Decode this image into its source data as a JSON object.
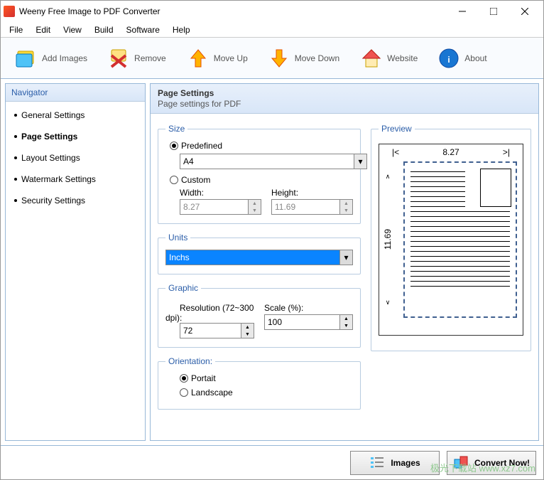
{
  "window": {
    "title": "Weeny Free Image to PDF Converter"
  },
  "menu": {
    "file": "File",
    "edit": "Edit",
    "view": "View",
    "build": "Build",
    "software": "Software",
    "help": "Help"
  },
  "toolbar": {
    "add": "Add Images",
    "remove": "Remove",
    "moveup": "Move Up",
    "movedown": "Move Down",
    "website": "Website",
    "about": "About"
  },
  "navigator": {
    "title": "Navigator",
    "items": [
      "General Settings",
      "Page Settings",
      "Layout Settings",
      "Watermark Settings",
      "Security Settings"
    ],
    "active_index": 1
  },
  "page_settings": {
    "title": "Page Settings",
    "subtitle": "Page settings for PDF",
    "size": {
      "legend": "Size",
      "predefined_label": "Predefined",
      "predefined_value": "A4",
      "custom_label": "Custom",
      "width_label": "Width:",
      "width_value": "8.27",
      "height_label": "Height:",
      "height_value": "11.69",
      "mode": "predefined"
    },
    "units": {
      "legend": "Units",
      "value": "Inchs"
    },
    "graphic": {
      "legend": "Graphic",
      "resolution_label": "Resolution (72~300 dpi):",
      "resolution_value": "72",
      "scale_label": "Scale (%):",
      "scale_value": "100"
    },
    "orientation": {
      "legend": "Orientation:",
      "portrait": "Portait",
      "landscape": "Landscape",
      "value": "portrait"
    },
    "preview": {
      "legend": "Preview",
      "width": "8.27",
      "height": "11.69"
    }
  },
  "footer": {
    "images": "Images",
    "convert": "Convert Now!"
  },
  "watermark": "极光下载站 www.xz7.com"
}
